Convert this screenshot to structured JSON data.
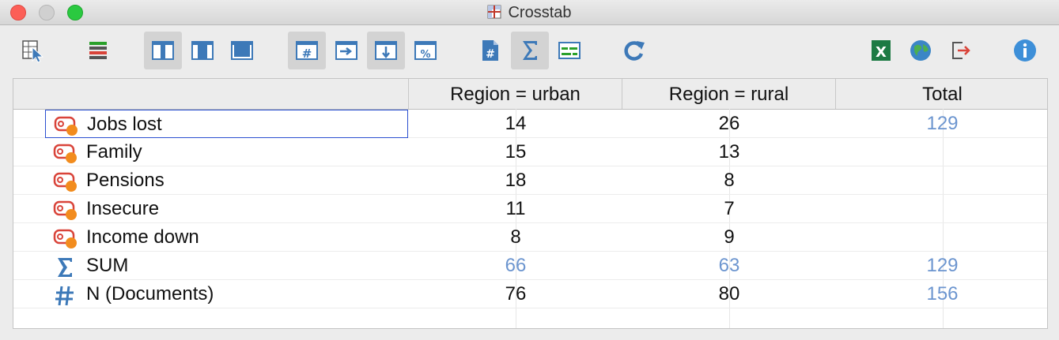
{
  "window": {
    "title": "Crosstab"
  },
  "colors": {
    "accent_blue": "#6c95cf",
    "code_red": "#d9443a",
    "code_dot": "#f28c1e",
    "toolbar_blue": "#3d79b8"
  },
  "toolbar": [
    {
      "name": "select-documents-icon",
      "active": false
    },
    {
      "name": "code-system-icon",
      "active": false
    },
    {
      "name": "layout-narrow-icon",
      "active": true
    },
    {
      "name": "layout-medium-icon",
      "active": false
    },
    {
      "name": "layout-wide-icon",
      "active": false
    },
    {
      "name": "show-frequencies-icon",
      "active": true
    },
    {
      "name": "row-percentages-icon",
      "active": false
    },
    {
      "name": "column-percentages-icon",
      "active": true
    },
    {
      "name": "total-percentages-icon",
      "active": false
    },
    {
      "name": "count-documents-icon",
      "active": false
    },
    {
      "name": "sum-icon",
      "active": true
    },
    {
      "name": "compact-view-icon",
      "active": false
    },
    {
      "name": "refresh-icon",
      "active": false
    },
    {
      "name": "export-excel-icon",
      "active": false
    },
    {
      "name": "export-html-icon",
      "active": false
    },
    {
      "name": "export-icon",
      "active": false
    },
    {
      "name": "info-icon",
      "active": false
    }
  ],
  "table": {
    "columns": [
      "Region = urban",
      "Region = rural",
      "Total"
    ],
    "rows": [
      {
        "label": "Jobs lost",
        "icon": "code-icon",
        "values": [
          "14",
          "26",
          "129"
        ],
        "blue": [
          false,
          false,
          true
        ]
      },
      {
        "label": "Family",
        "icon": "code-icon",
        "values": [
          "15",
          "13",
          ""
        ],
        "blue": [
          false,
          false,
          false
        ]
      },
      {
        "label": "Pensions",
        "icon": "code-icon",
        "values": [
          "18",
          "8",
          ""
        ],
        "blue": [
          false,
          false,
          false
        ]
      },
      {
        "label": "Insecure",
        "icon": "code-icon",
        "values": [
          "11",
          "7",
          ""
        ],
        "blue": [
          false,
          false,
          false
        ]
      },
      {
        "label": "Income down",
        "icon": "code-icon",
        "values": [
          "8",
          "9",
          ""
        ],
        "blue": [
          false,
          false,
          false
        ]
      },
      {
        "label": "SUM",
        "icon": "sigma-icon",
        "values": [
          "66",
          "63",
          "129"
        ],
        "blue": [
          true,
          true,
          true
        ]
      },
      {
        "label": "N (Documents)",
        "icon": "hash-icon",
        "values": [
          "76",
          "80",
          "156"
        ],
        "blue": [
          false,
          false,
          true
        ]
      }
    ]
  }
}
